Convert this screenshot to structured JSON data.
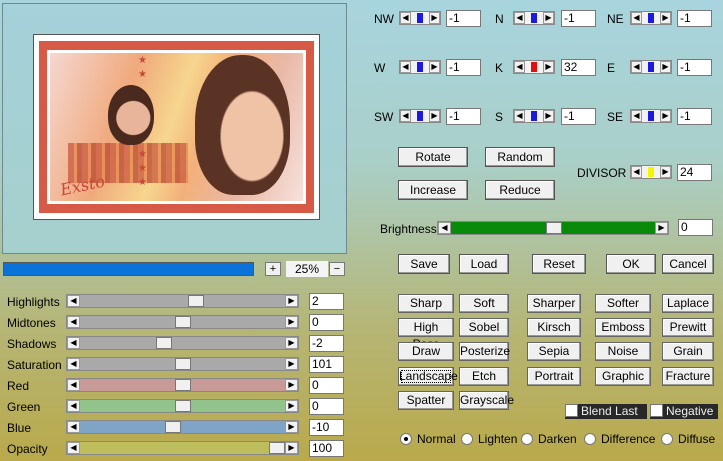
{
  "preview": {
    "signature": "Exsto",
    "zoom": "25%",
    "zoom_in": "+",
    "zoom_out": "−"
  },
  "adjust": [
    {
      "label": "Highlights",
      "value": "2",
      "level": 0.57
    },
    {
      "label": "Midtones",
      "value": "0",
      "level": 0.5
    },
    {
      "label": "Shadows",
      "value": "-2",
      "level": 0.4
    },
    {
      "label": "Saturation",
      "value": "101",
      "level": 0.5
    },
    {
      "label": "Red",
      "value": "0",
      "level": 0.5
    },
    {
      "label": "Green",
      "value": "0",
      "level": 0.5
    },
    {
      "label": "Blue",
      "value": "-10",
      "level": 0.45
    },
    {
      "label": "Opacity",
      "value": "100",
      "level": 1.0
    }
  ],
  "matrix": [
    {
      "label": "NW",
      "value": "-1"
    },
    {
      "label": "N",
      "value": "-1"
    },
    {
      "label": "NE",
      "value": "-1"
    },
    {
      "label": "W",
      "value": "-1"
    },
    {
      "label": "K",
      "value": "32"
    },
    {
      "label": "E",
      "value": "-1"
    },
    {
      "label": "SW",
      "value": "-1"
    },
    {
      "label": "S",
      "value": "-1"
    },
    {
      "label": "SE",
      "value": "-1"
    }
  ],
  "buttons": {
    "rotate": "Rotate",
    "random": "Random",
    "increase": "Increase",
    "reduce": "Reduce",
    "save": "Save",
    "load": "Load",
    "reset": "Reset",
    "ok": "OK",
    "cancel": "Cancel"
  },
  "divisor": {
    "label": "DIVISOR",
    "value": "24"
  },
  "brightness": {
    "label": "Brightness",
    "value": "0",
    "level": 0.5
  },
  "filters": [
    "Sharp",
    "Soft",
    "Sharper",
    "Softer",
    "Laplace",
    "High Pass",
    "Sobel",
    "Kirsch",
    "Emboss",
    "Prewitt",
    "Draw",
    "Posterize",
    "Sepia",
    "Noise",
    "Grain",
    "Landscape",
    "Etch",
    "Portrait",
    "Graphic",
    "Fracture",
    "Spatter",
    "Grayscale"
  ],
  "checks": {
    "blend_last": "Blend Last",
    "negative": "Negative"
  },
  "blend_modes": [
    {
      "label": "Normal",
      "selected": true
    },
    {
      "label": "Lighten",
      "selected": false
    },
    {
      "label": "Darken",
      "selected": false
    },
    {
      "label": "Difference",
      "selected": false
    },
    {
      "label": "Diffuse",
      "selected": false
    }
  ],
  "colors": {
    "red_track": "#c79a97",
    "green_track": "#93c38d",
    "blue_track": "#7fa4c6",
    "opacity_track": "#bebd5e",
    "gray_track": "#a9a9a9",
    "k_thumb": "#e01010",
    "divisor_thumb": "#f5f500"
  }
}
